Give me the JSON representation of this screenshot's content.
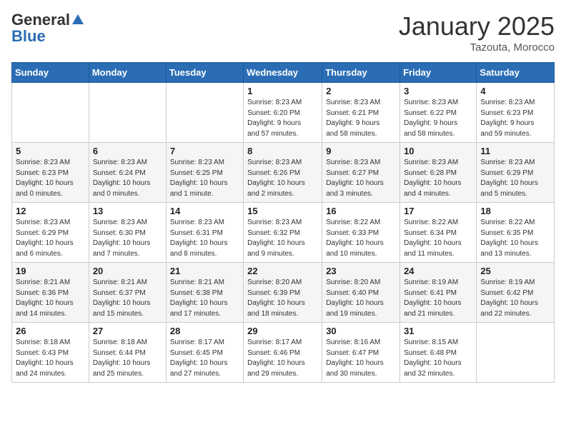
{
  "header": {
    "logo_general": "General",
    "logo_blue": "Blue",
    "month_title": "January 2025",
    "location": "Tazouta, Morocco"
  },
  "days_of_week": [
    "Sunday",
    "Monday",
    "Tuesday",
    "Wednesday",
    "Thursday",
    "Friday",
    "Saturday"
  ],
  "weeks": [
    [
      {
        "day": "",
        "info": ""
      },
      {
        "day": "",
        "info": ""
      },
      {
        "day": "",
        "info": ""
      },
      {
        "day": "1",
        "info": "Sunrise: 8:23 AM\nSunset: 6:20 PM\nDaylight: 9 hours\nand 57 minutes."
      },
      {
        "day": "2",
        "info": "Sunrise: 8:23 AM\nSunset: 6:21 PM\nDaylight: 9 hours\nand 58 minutes."
      },
      {
        "day": "3",
        "info": "Sunrise: 8:23 AM\nSunset: 6:22 PM\nDaylight: 9 hours\nand 58 minutes."
      },
      {
        "day": "4",
        "info": "Sunrise: 8:23 AM\nSunset: 6:23 PM\nDaylight: 9 hours\nand 59 minutes."
      }
    ],
    [
      {
        "day": "5",
        "info": "Sunrise: 8:23 AM\nSunset: 6:23 PM\nDaylight: 10 hours\nand 0 minutes."
      },
      {
        "day": "6",
        "info": "Sunrise: 8:23 AM\nSunset: 6:24 PM\nDaylight: 10 hours\nand 0 minutes."
      },
      {
        "day": "7",
        "info": "Sunrise: 8:23 AM\nSunset: 6:25 PM\nDaylight: 10 hours\nand 1 minute."
      },
      {
        "day": "8",
        "info": "Sunrise: 8:23 AM\nSunset: 6:26 PM\nDaylight: 10 hours\nand 2 minutes."
      },
      {
        "day": "9",
        "info": "Sunrise: 8:23 AM\nSunset: 6:27 PM\nDaylight: 10 hours\nand 3 minutes."
      },
      {
        "day": "10",
        "info": "Sunrise: 8:23 AM\nSunset: 6:28 PM\nDaylight: 10 hours\nand 4 minutes."
      },
      {
        "day": "11",
        "info": "Sunrise: 8:23 AM\nSunset: 6:29 PM\nDaylight: 10 hours\nand 5 minutes."
      }
    ],
    [
      {
        "day": "12",
        "info": "Sunrise: 8:23 AM\nSunset: 6:29 PM\nDaylight: 10 hours\nand 6 minutes."
      },
      {
        "day": "13",
        "info": "Sunrise: 8:23 AM\nSunset: 6:30 PM\nDaylight: 10 hours\nand 7 minutes."
      },
      {
        "day": "14",
        "info": "Sunrise: 8:23 AM\nSunset: 6:31 PM\nDaylight: 10 hours\nand 8 minutes."
      },
      {
        "day": "15",
        "info": "Sunrise: 8:23 AM\nSunset: 6:32 PM\nDaylight: 10 hours\nand 9 minutes."
      },
      {
        "day": "16",
        "info": "Sunrise: 8:22 AM\nSunset: 6:33 PM\nDaylight: 10 hours\nand 10 minutes."
      },
      {
        "day": "17",
        "info": "Sunrise: 8:22 AM\nSunset: 6:34 PM\nDaylight: 10 hours\nand 11 minutes."
      },
      {
        "day": "18",
        "info": "Sunrise: 8:22 AM\nSunset: 6:35 PM\nDaylight: 10 hours\nand 13 minutes."
      }
    ],
    [
      {
        "day": "19",
        "info": "Sunrise: 8:21 AM\nSunset: 6:36 PM\nDaylight: 10 hours\nand 14 minutes."
      },
      {
        "day": "20",
        "info": "Sunrise: 8:21 AM\nSunset: 6:37 PM\nDaylight: 10 hours\nand 15 minutes."
      },
      {
        "day": "21",
        "info": "Sunrise: 8:21 AM\nSunset: 6:38 PM\nDaylight: 10 hours\nand 17 minutes."
      },
      {
        "day": "22",
        "info": "Sunrise: 8:20 AM\nSunset: 6:39 PM\nDaylight: 10 hours\nand 18 minutes."
      },
      {
        "day": "23",
        "info": "Sunrise: 8:20 AM\nSunset: 6:40 PM\nDaylight: 10 hours\nand 19 minutes."
      },
      {
        "day": "24",
        "info": "Sunrise: 8:19 AM\nSunset: 6:41 PM\nDaylight: 10 hours\nand 21 minutes."
      },
      {
        "day": "25",
        "info": "Sunrise: 8:19 AM\nSunset: 6:42 PM\nDaylight: 10 hours\nand 22 minutes."
      }
    ],
    [
      {
        "day": "26",
        "info": "Sunrise: 8:18 AM\nSunset: 6:43 PM\nDaylight: 10 hours\nand 24 minutes."
      },
      {
        "day": "27",
        "info": "Sunrise: 8:18 AM\nSunset: 6:44 PM\nDaylight: 10 hours\nand 25 minutes."
      },
      {
        "day": "28",
        "info": "Sunrise: 8:17 AM\nSunset: 6:45 PM\nDaylight: 10 hours\nand 27 minutes."
      },
      {
        "day": "29",
        "info": "Sunrise: 8:17 AM\nSunset: 6:46 PM\nDaylight: 10 hours\nand 29 minutes."
      },
      {
        "day": "30",
        "info": "Sunrise: 8:16 AM\nSunset: 6:47 PM\nDaylight: 10 hours\nand 30 minutes."
      },
      {
        "day": "31",
        "info": "Sunrise: 8:15 AM\nSunset: 6:48 PM\nDaylight: 10 hours\nand 32 minutes."
      },
      {
        "day": "",
        "info": ""
      }
    ]
  ]
}
